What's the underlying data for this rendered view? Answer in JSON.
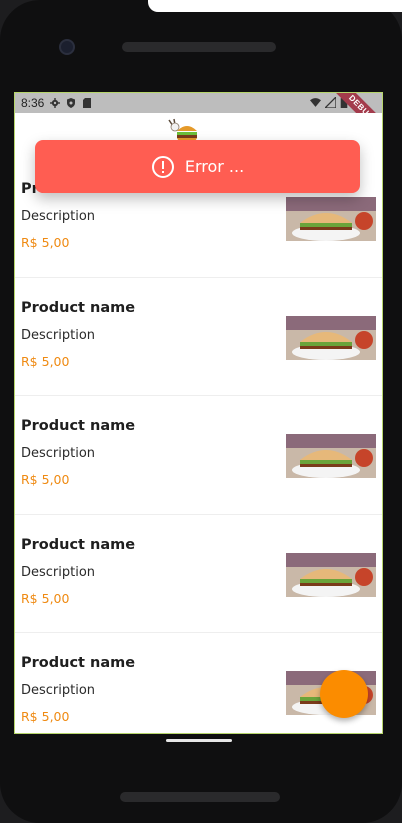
{
  "status_bar": {
    "time": "8:36",
    "debug_label": "DEBUG"
  },
  "toast": {
    "message": "Error ..."
  },
  "products": [
    {
      "name": "Product name",
      "description": "Description",
      "price": "R$ 5,00"
    },
    {
      "name": "Product name",
      "description": "Description",
      "price": "R$ 5,00"
    },
    {
      "name": "Product name",
      "description": "Description",
      "price": "R$ 5,00"
    },
    {
      "name": "Product name",
      "description": "Description",
      "price": "R$ 5,00"
    },
    {
      "name": "Product name",
      "description": "Description",
      "price": "R$ 5,00"
    }
  ],
  "colors": {
    "accent": "#fb8c00",
    "price": "#ef8a12",
    "toast": "#ff5d52"
  }
}
